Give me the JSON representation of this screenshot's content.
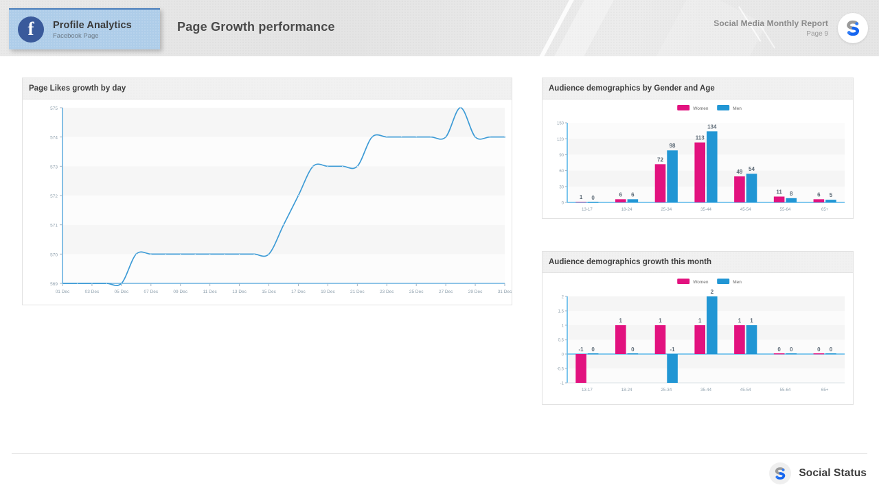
{
  "header": {
    "badge": {
      "icon": "facebook-icon",
      "title": "Profile Analytics",
      "subtitle": "Facebook Page"
    },
    "page_title": "Page Growth  performance",
    "report_name": "Social Media Monthly Report",
    "page_number": "Page 9",
    "logo_icon": "social-status-logo-icon"
  },
  "panels": {
    "line": {
      "title": "Page Likes growth by day"
    },
    "gender": {
      "title": "Audience demographics by Gender and Age"
    },
    "growth": {
      "title": "Audience demographics growth this month"
    }
  },
  "colors": {
    "women": "#e2127f",
    "men": "#2196d4",
    "line": "#3d9bd6",
    "axis": "#8fa0ad",
    "label": "#5c6b78"
  },
  "footer": {
    "brand": "Social Status",
    "logo_icon": "social-status-logo-icon"
  },
  "chart_data": [
    {
      "type": "line",
      "title": "Page Likes growth by day",
      "xlabel": "",
      "ylabel": "",
      "ylim": [
        569,
        575
      ],
      "yticks": [
        569,
        570,
        571,
        572,
        573,
        574,
        575
      ],
      "grid": true,
      "legend": "none",
      "xticks": [
        "01 Dec",
        "03 Dec",
        "05 Dec",
        "07 Dec",
        "09 Dec",
        "11 Dec",
        "13 Dec",
        "15 Dec",
        "17 Dec",
        "19 Dec",
        "21 Dec",
        "23 Dec",
        "25 Dec",
        "27 Dec",
        "29 Dec",
        "31 Dec"
      ],
      "x": [
        "01 Dec",
        "02 Dec",
        "03 Dec",
        "04 Dec",
        "05 Dec",
        "06 Dec",
        "07 Dec",
        "08 Dec",
        "09 Dec",
        "10 Dec",
        "11 Dec",
        "12 Dec",
        "13 Dec",
        "14 Dec",
        "15 Dec",
        "16 Dec",
        "17 Dec",
        "18 Dec",
        "19 Dec",
        "20 Dec",
        "21 Dec",
        "22 Dec",
        "23 Dec",
        "24 Dec",
        "25 Dec",
        "26 Dec",
        "27 Dec",
        "28 Dec",
        "29 Dec",
        "30 Dec",
        "31 Dec"
      ],
      "values": [
        569,
        569,
        569,
        569,
        569,
        570,
        570,
        570,
        570,
        570,
        570,
        570,
        570,
        570,
        570,
        571,
        572,
        573,
        573,
        573,
        573,
        574,
        574,
        574,
        574,
        574,
        574,
        575,
        574,
        574,
        574
      ]
    },
    {
      "type": "bar",
      "title": "Audience demographics by Gender and Age",
      "categories": [
        "13-17",
        "18-24",
        "25-34",
        "35-44",
        "45-54",
        "55-64",
        "65+"
      ],
      "series": [
        {
          "name": "Women",
          "values": [
            1,
            6,
            72,
            113,
            49,
            11,
            6
          ],
          "color": "#e2127f"
        },
        {
          "name": "Men",
          "values": [
            0,
            6,
            98,
            134,
            54,
            8,
            5
          ],
          "color": "#2196d4"
        }
      ],
      "ylim": [
        0,
        150
      ],
      "yticks": [
        0,
        30,
        60,
        90,
        120,
        150
      ],
      "xlabel": "",
      "ylabel": "",
      "grid": true,
      "legend": "top-center",
      "data_labels": true
    },
    {
      "type": "bar",
      "title": "Audience demographics growth this month",
      "categories": [
        "13-17",
        "18-24",
        "25-34",
        "35-44",
        "45-54",
        "55-64",
        "65+"
      ],
      "series": [
        {
          "name": "Women",
          "values": [
            -1,
            1,
            1,
            1,
            1,
            0,
            0
          ],
          "color": "#e2127f"
        },
        {
          "name": "Men",
          "values": [
            0,
            0,
            -1,
            2,
            1,
            0,
            0
          ],
          "color": "#2196d4"
        }
      ],
      "ylim": [
        -1,
        2
      ],
      "yticks": [
        -1,
        -0.5,
        0,
        0.5,
        1,
        1.5,
        2
      ],
      "ytick_labels": [
        "-1",
        "-0.5",
        "0",
        "0.5",
        "1",
        "1.5",
        "2"
      ],
      "xlabel": "",
      "ylabel": "",
      "grid": true,
      "legend": "top-center",
      "data_labels": true
    }
  ]
}
